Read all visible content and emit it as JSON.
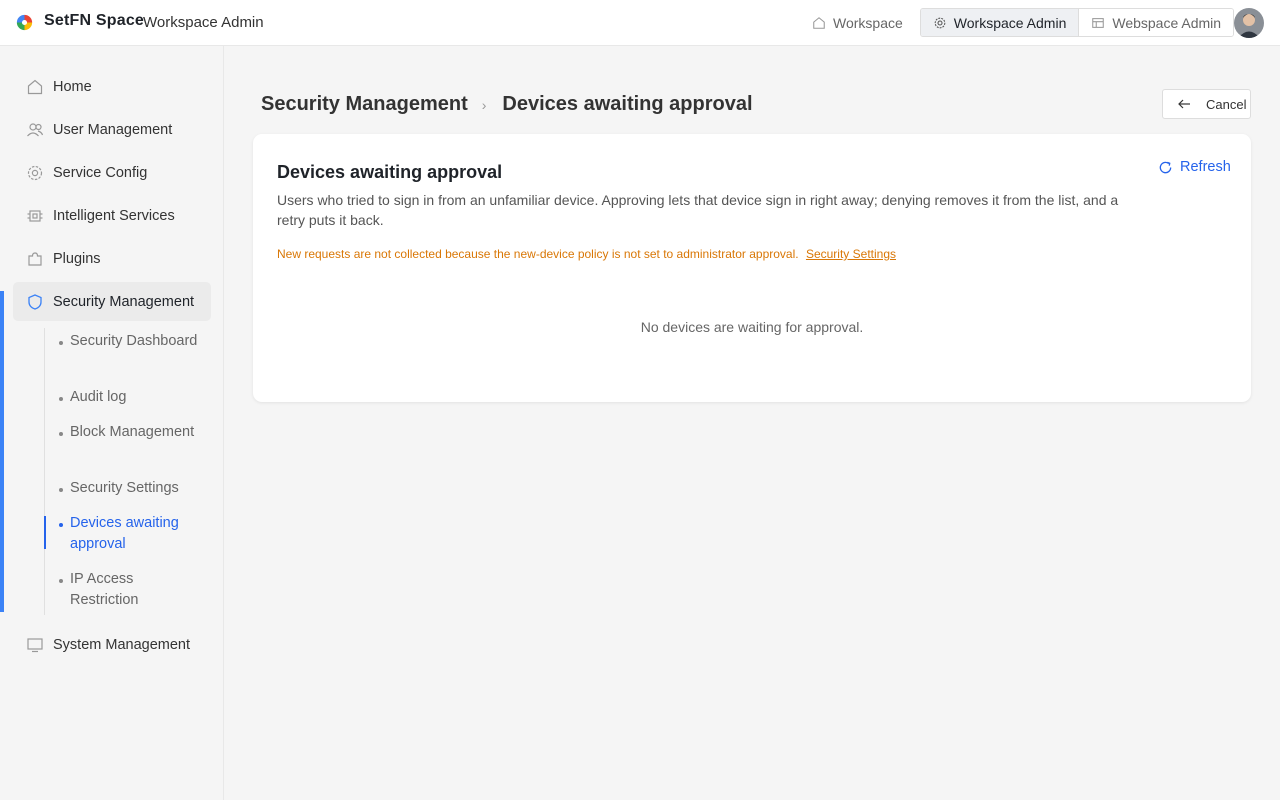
{
  "header": {
    "brand": "SetFN Space",
    "subtitle": "Workspace Admin",
    "nav": {
      "workspace": "Workspace",
      "workspace_admin": "Workspace Admin",
      "webspace_admin": "Webspace Admin"
    }
  },
  "sidebar": {
    "items": [
      {
        "label": "Home",
        "icon": "home-icon"
      },
      {
        "label": "User Management",
        "icon": "users-icon"
      },
      {
        "label": "Service Config",
        "icon": "gear-icon"
      },
      {
        "label": "Intelligent Services",
        "icon": "chip-icon"
      },
      {
        "label": "Plugins",
        "icon": "puzzle-icon"
      },
      {
        "label": "Security Management",
        "icon": "shield-icon"
      },
      {
        "label": "System Management",
        "icon": "monitor-icon"
      }
    ],
    "security_sub": [
      "Security Dashboard",
      "Audit log",
      "Block Management",
      "Security Settings",
      "Devices awaiting approval",
      "IP Access Restriction"
    ]
  },
  "breadcrumb": {
    "parent": "Security Management",
    "current": "Devices awaiting approval"
  },
  "cancel_label": "Cancel",
  "card": {
    "title": "Devices awaiting approval",
    "description": "Users who tried to sign in from an unfamiliar device. Approving lets that device sign in right away; denying removes it from the list, and a retry puts it back.",
    "warning": "New requests are not collected because the new-device policy is not set to administrator approval.",
    "warning_link": "Security Settings",
    "refresh_label": "Refresh",
    "empty_text": "No devices are waiting for approval."
  },
  "colors": {
    "accent": "#2563eb",
    "warning": "#d97706",
    "rail": "#3b82f6"
  }
}
